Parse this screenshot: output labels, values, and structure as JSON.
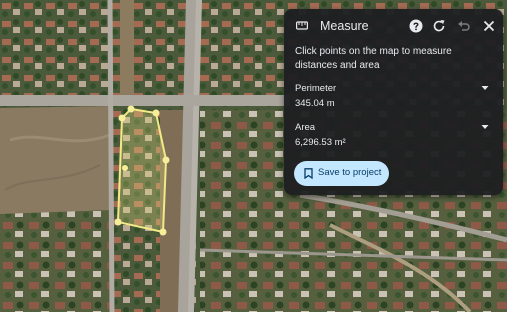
{
  "map": {
    "description": "satellite imagery with measure polygon"
  },
  "panel": {
    "title": "Measure",
    "icons": {
      "tool": "ruler-icon",
      "help": "help-icon",
      "refresh": "refresh-icon",
      "undo": "undo-icon",
      "close": "close-icon"
    },
    "instruction": "Click points on the map to measure distances and area",
    "perimeter": {
      "label": "Perimeter",
      "value": "345.04 m"
    },
    "area": {
      "label": "Area",
      "value": "6,296.53 m²"
    },
    "save_label": "Save to project"
  },
  "colors": {
    "panel_bg": "#1e1f21",
    "panel_text": "#e8eaed",
    "save_bg": "#c2e7ff",
    "save_text": "#0b3d66",
    "polygon": "#f2ea86"
  }
}
